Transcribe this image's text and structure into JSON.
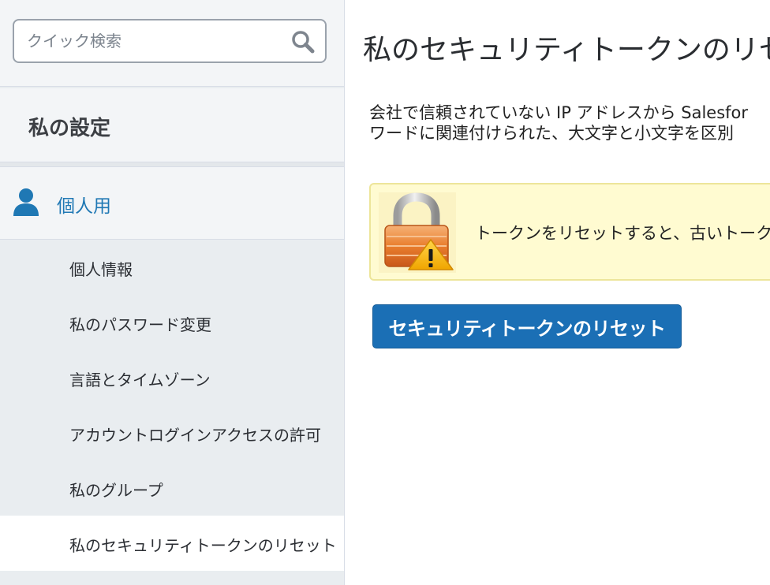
{
  "sidebar": {
    "search": {
      "placeholder": "クイック検索",
      "value": ""
    },
    "section_title": "私の設定",
    "personal": {
      "label": "個人用",
      "items": [
        {
          "label": "個人情報"
        },
        {
          "label": "私のパスワード変更"
        },
        {
          "label": "言語とタイムゾーン"
        },
        {
          "label": "アカウントログインアクセスの許可"
        },
        {
          "label": "私のグループ"
        },
        {
          "label": "私のセキュリティトークンのリセット",
          "selected": true
        }
      ]
    }
  },
  "main": {
    "title": "私のセキュリティトークンのリセット",
    "description_lines": [
      "会社で信頼されていない IP アドレスから Salesfor",
      "ワードに関連付けられた、大文字と小文字を区別"
    ],
    "notice": {
      "text": "トークンをリセットすると、古いトークンは"
    },
    "reset_button_label": "セキュリティトークンのリセット"
  },
  "colors": {
    "link_blue": "#1f78b4",
    "button_blue": "#1b6fb5",
    "notice_background": "#fffbd1",
    "sidebar_background": "#e9edf0"
  },
  "icons": {
    "search": "search-icon",
    "person": "person-icon",
    "lock_warning": "lock-warning-icon"
  }
}
